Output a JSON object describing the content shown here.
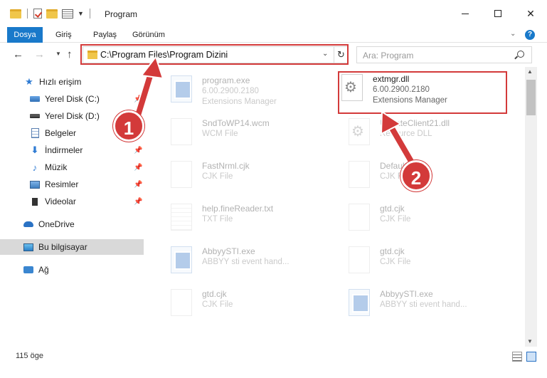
{
  "window": {
    "title": "Program",
    "controls": {
      "minimize": "",
      "maximize": "",
      "close": "✕"
    }
  },
  "ribbon": {
    "tabs": [
      "Dosya",
      "Giriş",
      "Paylaş",
      "Görünüm"
    ],
    "help": "?"
  },
  "navigation": {
    "address": "C:\\Program Files\\Program Dizini",
    "search_placeholder": "Ara: Program"
  },
  "sidebar": {
    "items": [
      {
        "label": "Hızlı erişim",
        "icon": "star-icon",
        "pinned": false
      },
      {
        "label": "Yerel Disk (C:)",
        "icon": "drive-c-icon",
        "pinned": true
      },
      {
        "label": "Yerel Disk (D:)",
        "icon": "drive-icon",
        "pinned": true
      },
      {
        "label": "Belgeler",
        "icon": "documents-icon",
        "pinned": true
      },
      {
        "label": "İndirmeler",
        "icon": "downloads-icon",
        "pinned": true
      },
      {
        "label": "Müzik",
        "icon": "music-icon",
        "pinned": true
      },
      {
        "label": "Resimler",
        "icon": "pictures-icon",
        "pinned": true
      },
      {
        "label": "Videolar",
        "icon": "videos-icon",
        "pinned": true
      },
      {
        "label": "OneDrive",
        "icon": "onedrive-icon",
        "pinned": false
      },
      {
        "label": "Bu bilgisayar",
        "icon": "this-pc-icon",
        "pinned": false,
        "selected": true
      },
      {
        "label": "Ağ",
        "icon": "network-icon",
        "pinned": false
      }
    ]
  },
  "files": [
    {
      "name": "program.exe",
      "line1": "6.00.2900.2180",
      "line2": "Extensions Manager",
      "icon": "app-icon",
      "faded": true
    },
    {
      "name": "extmgr.dll",
      "line1": "6.00.2900.2180",
      "line2": "Extensions Manager",
      "icon": "gear-file-icon",
      "faded": false
    },
    {
      "name": "SndToWP14.wcm",
      "line1": "WCM File",
      "line2": "",
      "icon": "file-icon",
      "faded": true
    },
    {
      "name": "UpdateClient21.dll",
      "line1": "Resource DLL",
      "line2": "",
      "icon": "gear-file-icon",
      "faded": true
    },
    {
      "name": "FastNrml.cjk",
      "line1": "CJK File",
      "line2": "",
      "icon": "file-icon",
      "faded": true
    },
    {
      "name": "Default.cjk",
      "line1": "CJK File",
      "line2": "",
      "icon": "file-icon",
      "faded": true
    },
    {
      "name": "help.fineReader.txt",
      "line1": "TXT File",
      "line2": "",
      "icon": "text-file-icon",
      "faded": true
    },
    {
      "name": "gtd.cjk",
      "line1": "CJK File",
      "line2": "",
      "icon": "file-icon",
      "faded": true
    },
    {
      "name": "AbbyySTI.exe",
      "line1": "ABBYY sti event hand...",
      "line2": "",
      "icon": "app-icon",
      "faded": true
    },
    {
      "name": "gtd.cjk",
      "line1": "CJK File",
      "line2": "",
      "icon": "file-icon",
      "faded": true
    },
    {
      "name": "gtd.cjk",
      "line1": "CJK File",
      "line2": "",
      "icon": "file-icon",
      "faded": true
    },
    {
      "name": "AbbyySTI.exe",
      "line1": "ABBYY sti event hand...",
      "line2": "",
      "icon": "app-icon",
      "faded": true
    }
  ],
  "status": {
    "item_count": "115 öge"
  },
  "annotations": {
    "step1": "1",
    "step2": "2",
    "accent": "#d33a3a"
  },
  "colors": {
    "ribbon_file_tab": "#1979ca",
    "selected_nav": "#d9d9d9",
    "highlight": "#d33a3a"
  }
}
